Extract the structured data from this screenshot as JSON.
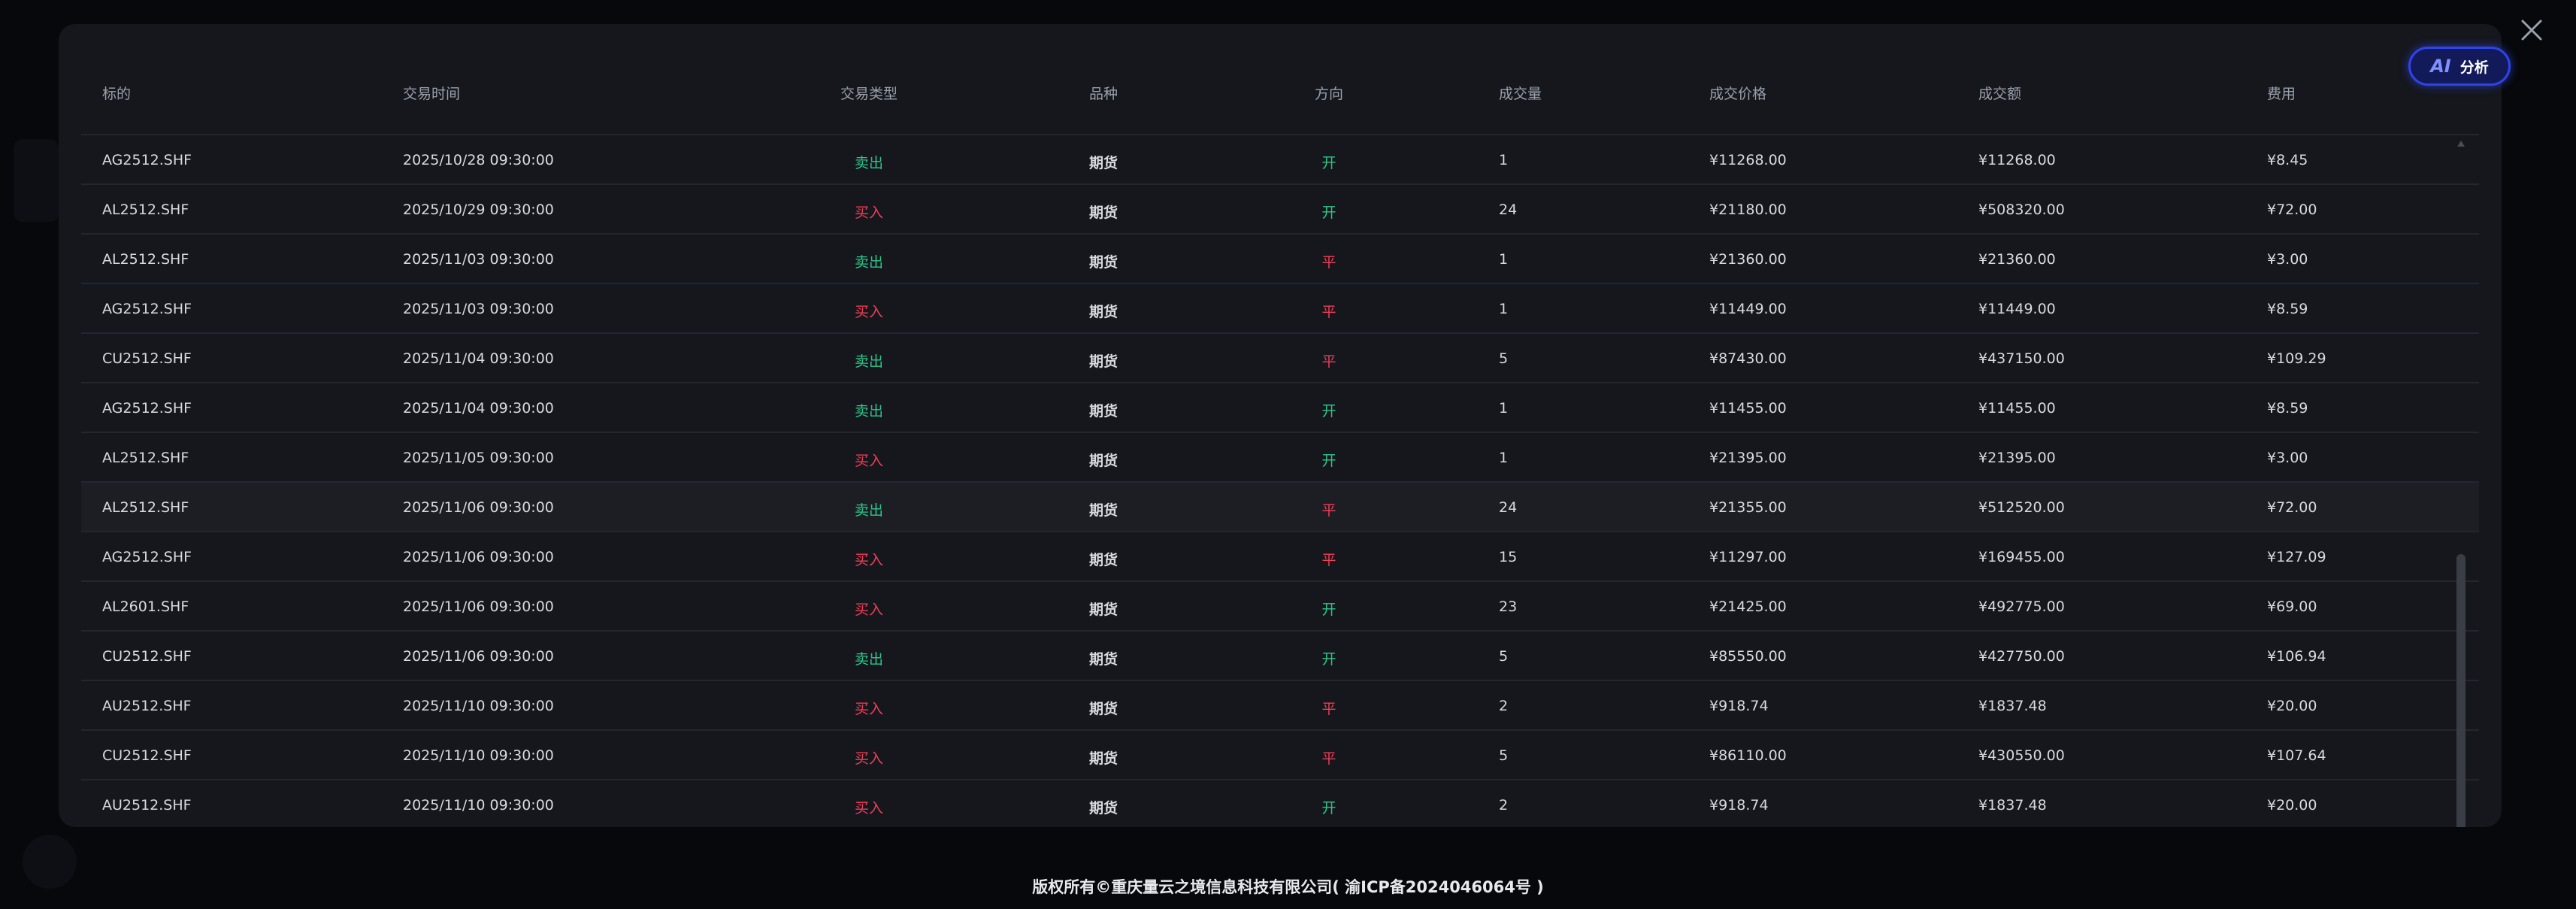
{
  "table": {
    "headers": {
      "symbol": "标的",
      "time": "交易时间",
      "trade_type": "交易类型",
      "variety": "品种",
      "direction": "方向",
      "volume": "成交量",
      "price": "成交价格",
      "amount": "成交额",
      "fee": "费用"
    },
    "rows": [
      {
        "symbol": "AG2512.SHF",
        "time": "2025/10/28 09:30:00",
        "trade_type": "卖出",
        "variety": "期货",
        "direction": "开",
        "volume": "1",
        "price": "¥11268.00",
        "amount": "¥11268.00",
        "fee": "¥8.45"
      },
      {
        "symbol": "AL2512.SHF",
        "time": "2025/10/29 09:30:00",
        "trade_type": "买入",
        "variety": "期货",
        "direction": "开",
        "volume": "24",
        "price": "¥21180.00",
        "amount": "¥508320.00",
        "fee": "¥72.00"
      },
      {
        "symbol": "AL2512.SHF",
        "time": "2025/11/03 09:30:00",
        "trade_type": "卖出",
        "variety": "期货",
        "direction": "平",
        "volume": "1",
        "price": "¥21360.00",
        "amount": "¥21360.00",
        "fee": "¥3.00"
      },
      {
        "symbol": "AG2512.SHF",
        "time": "2025/11/03 09:30:00",
        "trade_type": "买入",
        "variety": "期货",
        "direction": "平",
        "volume": "1",
        "price": "¥11449.00",
        "amount": "¥11449.00",
        "fee": "¥8.59"
      },
      {
        "symbol": "CU2512.SHF",
        "time": "2025/11/04 09:30:00",
        "trade_type": "卖出",
        "variety": "期货",
        "direction": "平",
        "volume": "5",
        "price": "¥87430.00",
        "amount": "¥437150.00",
        "fee": "¥109.29"
      },
      {
        "symbol": "AG2512.SHF",
        "time": "2025/11/04 09:30:00",
        "trade_type": "卖出",
        "variety": "期货",
        "direction": "开",
        "volume": "1",
        "price": "¥11455.00",
        "amount": "¥11455.00",
        "fee": "¥8.59"
      },
      {
        "symbol": "AL2512.SHF",
        "time": "2025/11/05 09:30:00",
        "trade_type": "买入",
        "variety": "期货",
        "direction": "开",
        "volume": "1",
        "price": "¥21395.00",
        "amount": "¥21395.00",
        "fee": "¥3.00"
      },
      {
        "symbol": "AL2512.SHF",
        "time": "2025/11/06 09:30:00",
        "trade_type": "卖出",
        "variety": "期货",
        "direction": "平",
        "volume": "24",
        "price": "¥21355.00",
        "amount": "¥512520.00",
        "fee": "¥72.00"
      },
      {
        "symbol": "AG2512.SHF",
        "time": "2025/11/06 09:30:00",
        "trade_type": "买入",
        "variety": "期货",
        "direction": "平",
        "volume": "15",
        "price": "¥11297.00",
        "amount": "¥169455.00",
        "fee": "¥127.09"
      },
      {
        "symbol": "AL2601.SHF",
        "time": "2025/11/06 09:30:00",
        "trade_type": "买入",
        "variety": "期货",
        "direction": "开",
        "volume": "23",
        "price": "¥21425.00",
        "amount": "¥492775.00",
        "fee": "¥69.00"
      },
      {
        "symbol": "CU2512.SHF",
        "time": "2025/11/06 09:30:00",
        "trade_type": "卖出",
        "variety": "期货",
        "direction": "开",
        "volume": "5",
        "price": "¥85550.00",
        "amount": "¥427750.00",
        "fee": "¥106.94"
      },
      {
        "symbol": "AU2512.SHF",
        "time": "2025/11/10 09:30:00",
        "trade_type": "买入",
        "variety": "期货",
        "direction": "平",
        "volume": "2",
        "price": "¥918.74",
        "amount": "¥1837.48",
        "fee": "¥20.00"
      },
      {
        "symbol": "CU2512.SHF",
        "time": "2025/11/10 09:30:00",
        "trade_type": "买入",
        "variety": "期货",
        "direction": "平",
        "volume": "5",
        "price": "¥86110.00",
        "amount": "¥430550.00",
        "fee": "¥107.64"
      },
      {
        "symbol": "AU2512.SHF",
        "time": "2025/11/10 09:30:00",
        "trade_type": "买入",
        "variety": "期货",
        "direction": "开",
        "volume": "2",
        "price": "¥918.74",
        "amount": "¥1837.48",
        "fee": "¥20.00"
      }
    ],
    "highlighted_row": 7
  },
  "ai_button": {
    "logo": "AI",
    "label": "分析"
  },
  "close_icon": "close-icon",
  "colors": {
    "sell": "#2ec58a",
    "buy": "#f23e57",
    "open": "#2ec58a",
    "close": "#f23e57",
    "accent": "#2f44e8"
  },
  "footer": {
    "copyright": "版权所有©重庆量云之境信息科技有限公司( 渝ICP备2024046064号 )"
  }
}
